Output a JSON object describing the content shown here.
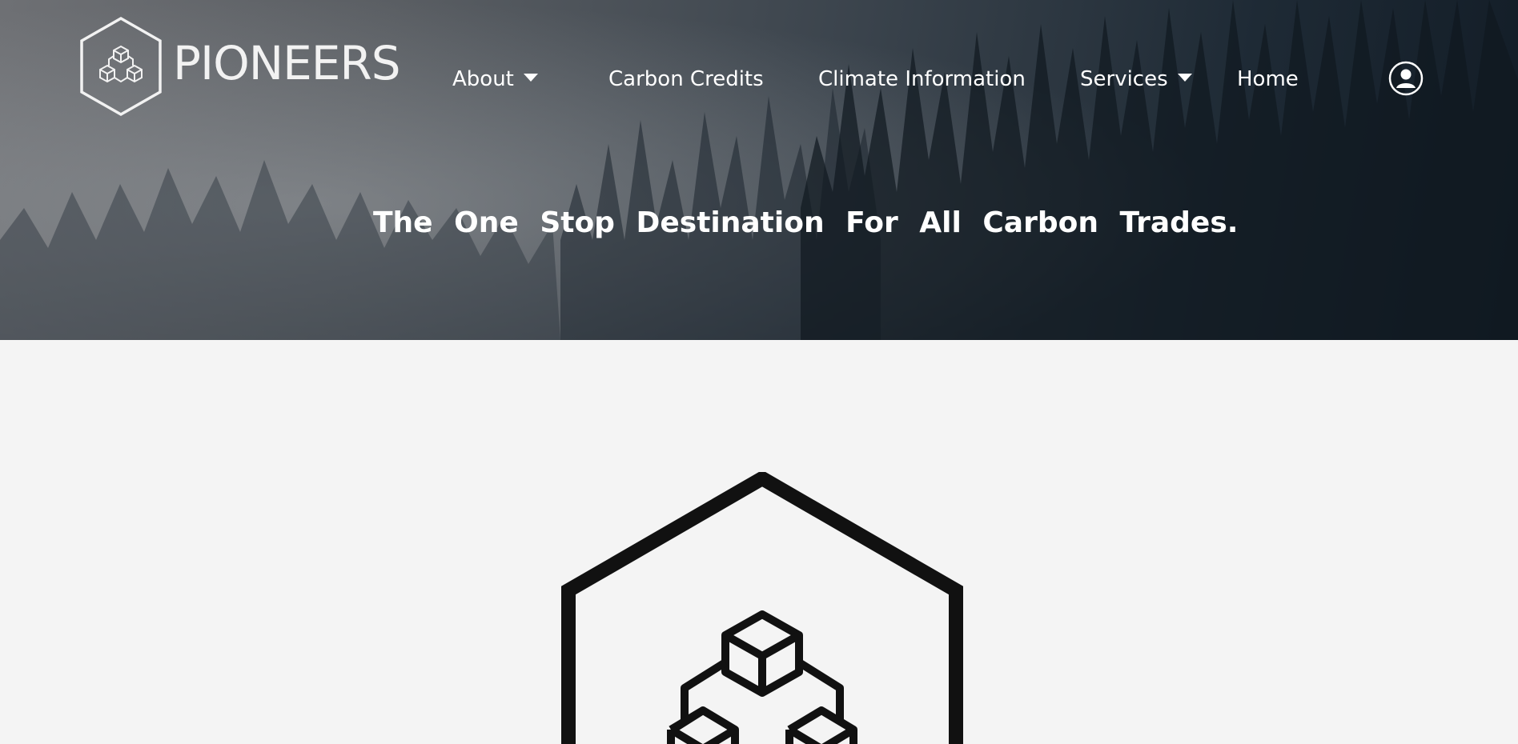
{
  "header": {
    "logo_icon": "hexagon-cubes-icon",
    "logo_text": "PIONEERS"
  },
  "nav": {
    "items": [
      {
        "label": "About",
        "has_dropdown": true
      },
      {
        "label": "Carbon Credits",
        "has_dropdown": false
      },
      {
        "label": "Climate Information",
        "has_dropdown": false
      },
      {
        "label": "Services",
        "has_dropdown": true
      },
      {
        "label": "Home",
        "has_dropdown": false
      }
    ],
    "user_icon": "user-circle-icon"
  },
  "hero": {
    "headline": "The One Stop Destination For All Carbon Trades."
  },
  "main": {
    "logo_icon": "hexagon-cubes-icon"
  },
  "colors": {
    "nav_text": "#ffffff",
    "page_background": "#f4f4f4",
    "logo_stroke": "#111111"
  }
}
